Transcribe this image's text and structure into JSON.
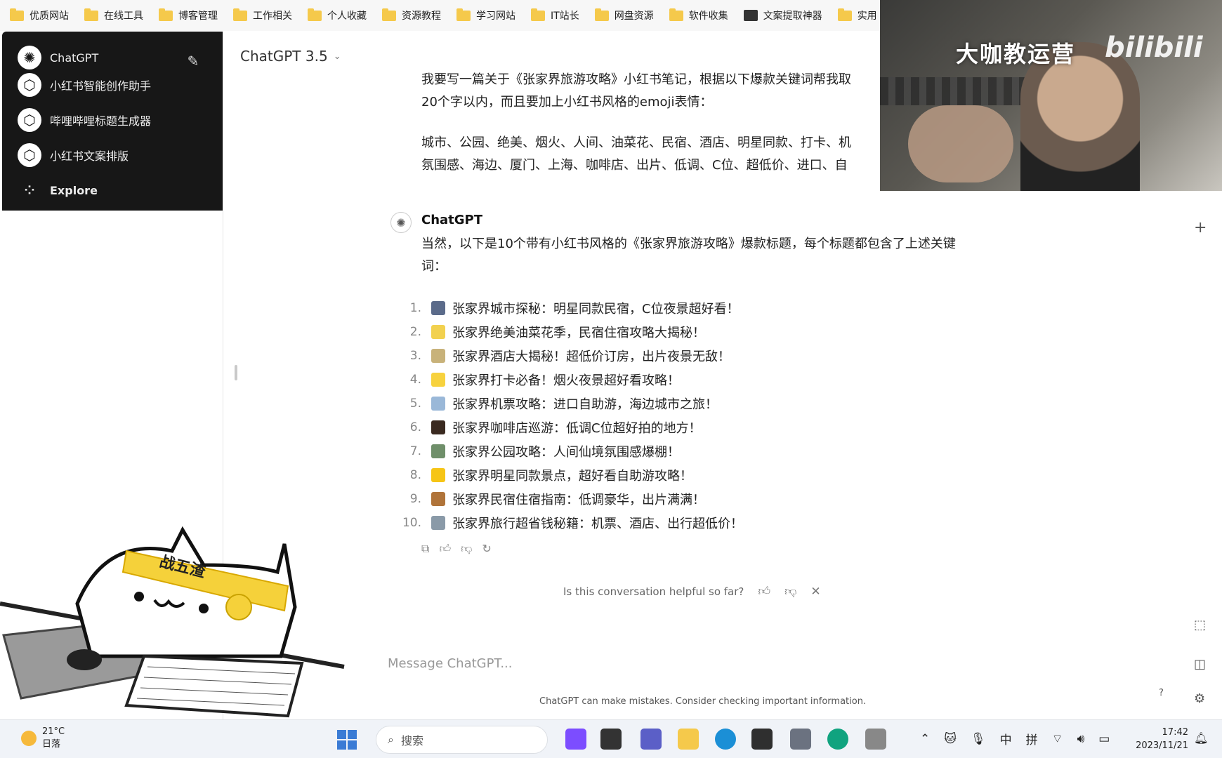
{
  "bookmarks": [
    "优质网站",
    "在线工具",
    "博客管理",
    "工作相关",
    "个人收藏",
    "资源教程",
    "学习网站",
    "IT站长",
    "网盘资源",
    "软件收集",
    "文案提取神器",
    "实用"
  ],
  "sidebar": {
    "items": [
      {
        "label": "ChatGPT",
        "icon": "openai-logo-icon"
      },
      {
        "label": "小红书智能创作助手",
        "icon": "gpt-cube-icon"
      },
      {
        "label": "哔哩哔哩标题生成器",
        "icon": "gpt-cube-icon"
      },
      {
        "label": "小红书文案排版",
        "icon": "gpt-cube-icon"
      },
      {
        "label": "Explore",
        "icon": "explore-grid-icon"
      }
    ]
  },
  "header": {
    "model": "ChatGPT 3.5"
  },
  "user_message": {
    "lines": [
      "我要写一篇关于《张家界旅游攻略》小红书笔记，根据以下爆款关键词帮我取",
      "20个字以内，而且要加上小红书风格的emoji表情：",
      "城市、公园、绝美、烟火、人间、油菜花、民宿、酒店、明星同款、打卡、机",
      "氛围感、海边、厦门、上海、咖啡店、出片、低调、C位、超低价、进口、自"
    ]
  },
  "assistant": {
    "name": "ChatGPT",
    "intro_line1": "当然，以下是10个带有小红书风格的《张家界旅游攻略》爆款标题，每个标题都包含了上述关键",
    "intro_line2": "词：",
    "items": [
      {
        "num": "1.",
        "emoji_color": "#5b6b8a",
        "text": "张家界城市探秘：明星同款民宿，C位夜景超好看！"
      },
      {
        "num": "2.",
        "emoji_color": "#f2d14f",
        "text": "张家界绝美油菜花季，民宿住宿攻略大揭秘！"
      },
      {
        "num": "3.",
        "emoji_color": "#c8b27a",
        "text": "张家界酒店大揭秘！超低价订房，出片夜景无敌！"
      },
      {
        "num": "4.",
        "emoji_color": "#f7d23e",
        "text": "张家界打卡必备！烟火夜景超好看攻略！"
      },
      {
        "num": "5.",
        "emoji_color": "#9ab8d8",
        "text": "张家界机票攻略：进口自助游，海边城市之旅！"
      },
      {
        "num": "6.",
        "emoji_color": "#3a2a20",
        "text": "张家界咖啡店巡游：低调C位超好拍的地方！"
      },
      {
        "num": "7.",
        "emoji_color": "#6f8f6a",
        "text": "张家界公园攻略：人间仙境氛围感爆棚！"
      },
      {
        "num": "8.",
        "emoji_color": "#f6c516",
        "text": "张家界明星同款景点，超好看自助游攻略！"
      },
      {
        "num": "9.",
        "emoji_color": "#b0743a",
        "text": "张家界民宿住宿指南：低调豪华，出片满满！"
      },
      {
        "num": "10.",
        "emoji_color": "#8a9aa8",
        "text": "张家界旅行超省钱秘籍：机票、酒店、出行超低价！"
      }
    ]
  },
  "feedback": {
    "question": "Is this conversation helpful so far?"
  },
  "composer": {
    "placeholder": "Message ChatGPT..."
  },
  "disclaimer": "ChatGPT can make mistakes. Consider checking important information.",
  "webcam": {
    "watermark": "大咖教运营",
    "logo_text": "bilibili"
  },
  "cat_sticker": {
    "headband": "战五渣"
  },
  "taskbar": {
    "weather_temp": "21°C",
    "weather_desc": "日落",
    "search_placeholder": "搜索",
    "tray": {
      "lang1": "中",
      "lang2": "拼"
    },
    "time": "17:42",
    "date": "2023/11/21"
  },
  "colors": {
    "sidebar_bg": "#171717",
    "accent": "#10a37f"
  }
}
